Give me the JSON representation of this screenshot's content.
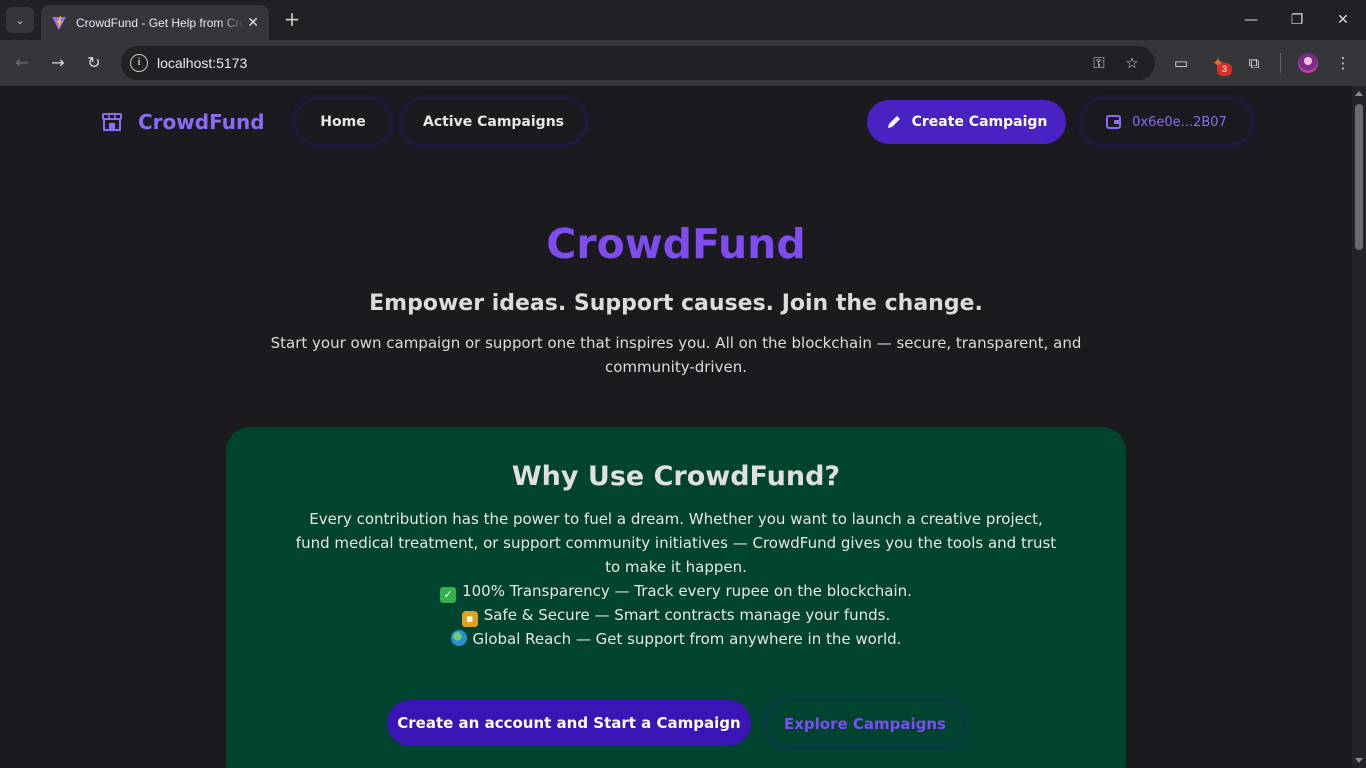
{
  "browser": {
    "tab_title": "CrowdFund - Get Help from Crowd",
    "url": "localhost:5173",
    "extension_badge": "3",
    "icons": {
      "tab_search": "chevron-down-icon",
      "close_tab": "close-icon",
      "new_tab": "plus-icon",
      "back": "arrow-left-icon",
      "forward": "arrow-right-icon",
      "reload": "reload-icon",
      "site_info": "info-icon",
      "password": "key-icon",
      "bookmark": "star-icon",
      "cast": "cast-icon",
      "extension": "extension-icon",
      "extensions_menu": "puzzle-icon",
      "profile": "avatar",
      "menu": "kebab-menu-icon"
    }
  },
  "navbar": {
    "brand": "CrowdFund",
    "links": [
      "Home",
      "Active Campaigns"
    ],
    "create_button": "Create Campaign",
    "wallet_address": "0x6e0e...2B07"
  },
  "hero": {
    "title": "CrowdFund",
    "tagline": "Empower ideas. Support causes. Join the change.",
    "description": "Start your own campaign or support one that inspires you. All on the blockchain — secure, transparent, and community-driven."
  },
  "why": {
    "title": "Why Use CrowdFund?",
    "text": "Every contribution has the power to fuel a dream. Whether you want to launch a creative project, fund medical treatment, or support community initiatives — CrowdFund gives you the tools and trust to make it happen.",
    "features": [
      {
        "icon": "check-emoji",
        "text": "100% Transparency — Track every rupee on the blockchain."
      },
      {
        "icon": "lock-emoji",
        "text": "Safe & Secure — Smart contracts manage your funds."
      },
      {
        "icon": "globe-emoji",
        "text": "Global Reach — Get support from anywhere in the world."
      }
    ],
    "primary_button": "Create an account and Start a Campaign",
    "secondary_button": "Explore Campaigns"
  },
  "colors": {
    "accent": "#7f4cf0",
    "button_primary": "#4a22c4",
    "card_background": "#004430",
    "page_background": "#1b1a1e"
  }
}
